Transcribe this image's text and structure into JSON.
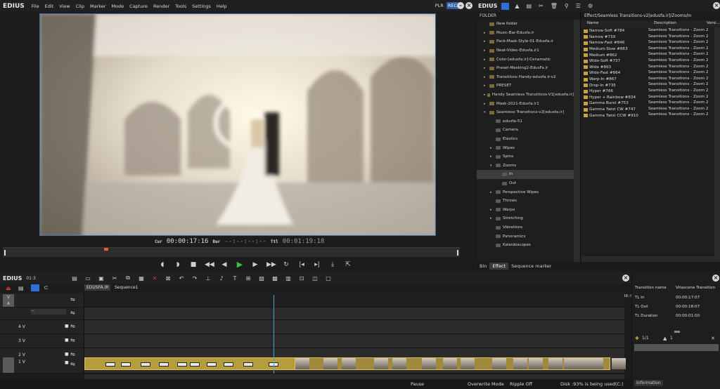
{
  "app": {
    "name": "EDIUS"
  },
  "menu": [
    "File",
    "Edit",
    "View",
    "Clip",
    "Marker",
    "Mode",
    "Capture",
    "Render",
    "Tools",
    "Settings",
    "Help"
  ],
  "player": {
    "plr": "PLR",
    "rec": "REC"
  },
  "timecodes": {
    "cur_label": "Cur",
    "cur": "00:00:17:16",
    "dur_label": "Dur",
    "dur": "--:--:--:--",
    "ttl_label": "Ttl",
    "ttl": "00:01:19:18"
  },
  "bin": {
    "folder_label": "FOLDER",
    "tree": [
      {
        "label": "New folder",
        "indent": 0,
        "arrow": ""
      },
      {
        "label": "Music-Bar-Edusfa.ir",
        "indent": 0,
        "arrow": "▸"
      },
      {
        "label": "Pack-Mask-Style-01-Edusfa.ir",
        "indent": 0,
        "arrow": "▸"
      },
      {
        "label": "Neat-Video-Edusfa.ir1",
        "indent": 0,
        "arrow": "▸"
      },
      {
        "label": "Color-[edusfa.ir]-Cenamatic",
        "indent": 0,
        "arrow": "▸"
      },
      {
        "label": "Preset-Masking2-EdusFa.ir",
        "indent": 0,
        "arrow": "▸"
      },
      {
        "label": "Transitions Handy-edusfa.ir-v2",
        "indent": 0,
        "arrow": "▸"
      },
      {
        "label": "PRESET",
        "indent": 0,
        "arrow": "▸"
      },
      {
        "label": "Handy Seamless Transitions-V1[edusfa.ir]",
        "indent": 0,
        "arrow": "▸"
      },
      {
        "label": "Mask-2021-Edusfa.ir1",
        "indent": 0,
        "arrow": "▸"
      },
      {
        "label": "Seamless Transitions-v2[edusfa.ir]",
        "indent": 0,
        "arrow": "▾"
      },
      {
        "label": "edusfa-51",
        "indent": 1,
        "arrow": ""
      },
      {
        "label": "Camera",
        "indent": 1,
        "arrow": ""
      },
      {
        "label": "Elastics",
        "indent": 1,
        "arrow": ""
      },
      {
        "label": "Wipes",
        "indent": 1,
        "arrow": "▸"
      },
      {
        "label": "Spins",
        "indent": 1,
        "arrow": "▸"
      },
      {
        "label": "Zooms",
        "indent": 1,
        "arrow": "▾"
      },
      {
        "label": "In",
        "indent": 2,
        "arrow": "",
        "selected": true
      },
      {
        "label": "Out",
        "indent": 2,
        "arrow": ""
      },
      {
        "label": "Perspective Wipes",
        "indent": 1,
        "arrow": "▸"
      },
      {
        "label": "Throws",
        "indent": 1,
        "arrow": ""
      },
      {
        "label": "Warps",
        "indent": 1,
        "arrow": "▸"
      },
      {
        "label": "Stretching",
        "indent": 1,
        "arrow": "▸"
      },
      {
        "label": "Vibrations",
        "indent": 1,
        "arrow": ""
      },
      {
        "label": "Panoramics",
        "indent": 1,
        "arrow": ""
      },
      {
        "label": "Kaleidoscopes",
        "indent": 1,
        "arrow": ""
      }
    ],
    "path": "Effect/Seamless Transitions-v2[edusfa.ir]/Zooms/In",
    "columns": [
      "Name",
      "Description",
      "Versi..."
    ],
    "effects": [
      {
        "name": "Narrow-Soft #784",
        "desc": "Seamless Transitions - Zoom 2.00"
      },
      {
        "name": "Narrow #739",
        "desc": "Seamless Transitions - Zoom 2.00"
      },
      {
        "name": "Narrow-Fast #846",
        "desc": "Seamless Transitions - Zoom 2.00"
      },
      {
        "name": "Medium-Slow #863",
        "desc": "Seamless Transitions - Zoom 2.00"
      },
      {
        "name": "Medium #862",
        "desc": "Seamless Transitions - Zoom 2.00"
      },
      {
        "name": "Wide-Soft #737",
        "desc": "Seamless Transitions - Zoom 2.00"
      },
      {
        "name": "Wide #863",
        "desc": "Seamless Transitions - Zoom 2.00"
      },
      {
        "name": "Wide-Fast #864",
        "desc": "Seamless Transitions - Zoom 2.00"
      },
      {
        "name": "Warp-In #867",
        "desc": "Seamless Transitions - Zoom 2.00"
      },
      {
        "name": "Drop-In #735",
        "desc": "Seamless Transitions - Zoom 2.00"
      },
      {
        "name": "Hyper #766",
        "desc": "Seamless Transitions - Zoom 2.00"
      },
      {
        "name": "Hyper + Rainbow #834",
        "desc": "Seamless Transitions - Zoom 2.00"
      },
      {
        "name": "Gamma Burst #753",
        "desc": "Seamless Transitions - Zoom 2.00"
      },
      {
        "name": "Gamma Twist CW #747",
        "desc": "Seamless Transitions - Zoom 2.00"
      },
      {
        "name": "Gamma Twist CCW #910",
        "desc": "Seamless Transitions - Zoom 2.00"
      }
    ],
    "tabs": [
      "Bin",
      "Effect",
      "Sequence marker"
    ]
  },
  "timeline": {
    "label": "EDIUS",
    "version": "01:3",
    "tabs": [
      "EDUSFA.IR",
      "Sequence1"
    ],
    "ruler": [
      "00:00:00:00",
      "00:00:04:00",
      "00:00:08:00",
      "00:00:12:00",
      "00:00:16:00",
      "00:00:20:00",
      "00:00:24:00",
      "00:00:28:00",
      "00:00:32:00",
      "00:00:36:00",
      "00:00:40:00",
      "00:00:44:00",
      "00:00:48:00"
    ],
    "tracks": [
      "4 V",
      "3 V",
      "2 V",
      "1 V"
    ],
    "va": {
      "v": "V",
      "a": "A"
    }
  },
  "info": {
    "rows": [
      {
        "k": "Transition name",
        "v": "Vitascene Transition"
      },
      {
        "k": "TL In",
        "v": "00:00:17:07"
      },
      {
        "k": "TL Out",
        "v": "00:00:18:07"
      },
      {
        "k": "TL Duration",
        "v": "00:00:01:00"
      }
    ],
    "count": "1/1",
    "tab": "Information"
  },
  "status": {
    "pause": "Pause",
    "overwrite": "Overwrite Mode",
    "ripple": "Ripple Off",
    "disk": "Disk :93% is being used(C:)"
  }
}
